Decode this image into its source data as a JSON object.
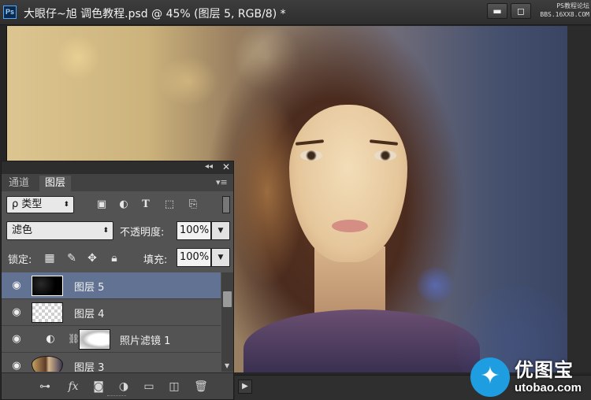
{
  "window": {
    "app_icon": "Ps",
    "title": "大眼仔~旭 调色教程.psd @ 45% (图层 5, RGB/8) *",
    "minimize": "▬",
    "maximize": "◻",
    "watermark_line1": "PS教程论坛",
    "watermark_line2": "BBS.16XX8.COM"
  },
  "canvas": {
    "play_button": "▶"
  },
  "brand_watermark": {
    "icon": "twitter-bird-icon",
    "name": "优图宝",
    "url": "utobao.com"
  },
  "panel": {
    "collapse": "◂◂",
    "close": "✕",
    "menu": "▾≡",
    "tabs": [
      {
        "label": "通道",
        "active": false
      },
      {
        "label": "图层",
        "active": true
      }
    ],
    "filter": {
      "kind_label": "ρ 类型",
      "icons": [
        "image-filter-icon",
        "adjustment-filter-icon",
        "type-filter-icon",
        "shape-filter-icon",
        "smart-object-filter-icon"
      ]
    },
    "blend_mode": "滤色",
    "opacity_label": "不透明度:",
    "opacity_value": "100%",
    "lock_label": "锁定:",
    "fill_label": "填充:",
    "fill_value": "100%",
    "layers": [
      {
        "name": "图层 5",
        "selected": true,
        "thumb": "black"
      },
      {
        "name": "图层 4",
        "selected": false,
        "thumb": "checker"
      },
      {
        "name": "照片滤镜 1",
        "selected": false,
        "thumb": "adjustment-with-mask"
      },
      {
        "name": "图层 3",
        "selected": false,
        "thumb": "photo"
      }
    ],
    "footer_icons": [
      "link-layers-icon",
      "fx-icon",
      "add-mask-icon",
      "new-adjustment-icon",
      "new-group-icon",
      "new-layer-icon",
      "delete-layer-icon"
    ],
    "fx_label": "fx"
  },
  "colors": {
    "selected_layer": "#627292",
    "panel_bg": "#535353",
    "title_bg": "#333333"
  }
}
